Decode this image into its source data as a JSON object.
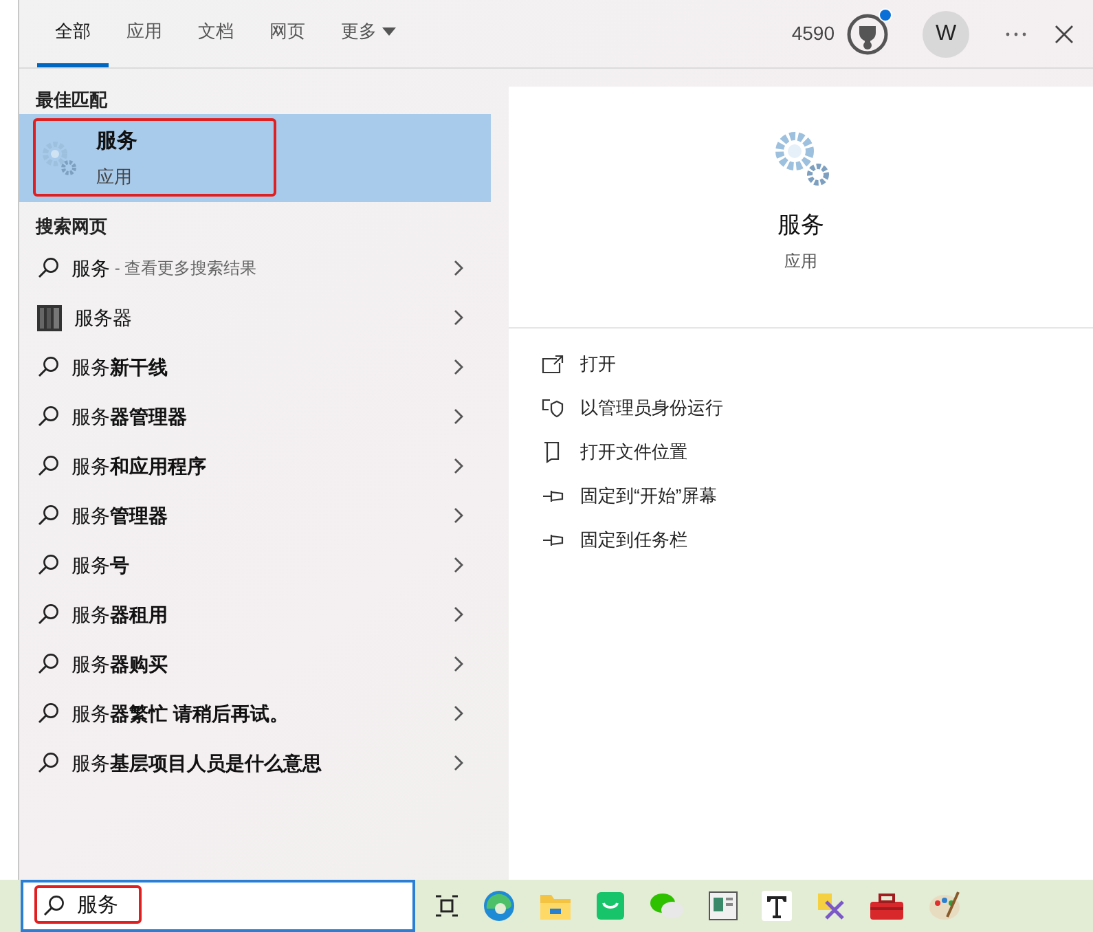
{
  "tabs": [
    {
      "label": "全部",
      "selected": true
    },
    {
      "label": "应用",
      "selected": false
    },
    {
      "label": "文档",
      "selected": false
    },
    {
      "label": "网页",
      "selected": false
    },
    {
      "label": "更多",
      "selected": false,
      "dropdown": true
    }
  ],
  "header": {
    "points": "4590",
    "avatar": "W",
    "notification": true
  },
  "best_match": {
    "heading": "最佳匹配",
    "title": "服务",
    "subtitle": "应用",
    "selected": true
  },
  "web_heading": "搜索网页",
  "suggestions": [
    {
      "kind": "search",
      "text": "服务",
      "hint": " - 查看更多搜索结果"
    },
    {
      "kind": "image",
      "text": "服务器"
    },
    {
      "kind": "search",
      "text": "服务**新干线**"
    },
    {
      "kind": "search",
      "text": "服务**器管理器**"
    },
    {
      "kind": "search",
      "text": "服务**和应用程序**"
    },
    {
      "kind": "search",
      "text": "服务**管理器**"
    },
    {
      "kind": "search",
      "text": "服务**号**"
    },
    {
      "kind": "search",
      "text": "服务**器租用**"
    },
    {
      "kind": "search",
      "text": "服务**器购买**"
    },
    {
      "kind": "search",
      "text": "服务**器繁忙 请稍后再试。**"
    },
    {
      "kind": "search",
      "text": "服务**基层项目人员是什么意思**"
    }
  ],
  "detail": {
    "title": "服务",
    "subtitle": "应用",
    "actions": [
      {
        "kind": "open",
        "label": "打开"
      },
      {
        "kind": "admin",
        "label": "以管理员身份运行"
      },
      {
        "kind": "folder",
        "label": "打开文件位置"
      },
      {
        "kind": "pin",
        "label": "固定到“开始”屏幕"
      },
      {
        "kind": "pin",
        "label": "固定到任务栏"
      }
    ]
  },
  "search_box": {
    "value": "服务"
  },
  "taskbar": [
    {
      "kind": "taskview"
    },
    {
      "kind": "edge"
    },
    {
      "kind": "explorer"
    },
    {
      "kind": "store"
    },
    {
      "kind": "chat"
    },
    {
      "kind": "reader"
    },
    {
      "kind": "font"
    },
    {
      "kind": "tools"
    },
    {
      "kind": "toolbox"
    },
    {
      "kind": "paint"
    }
  ]
}
